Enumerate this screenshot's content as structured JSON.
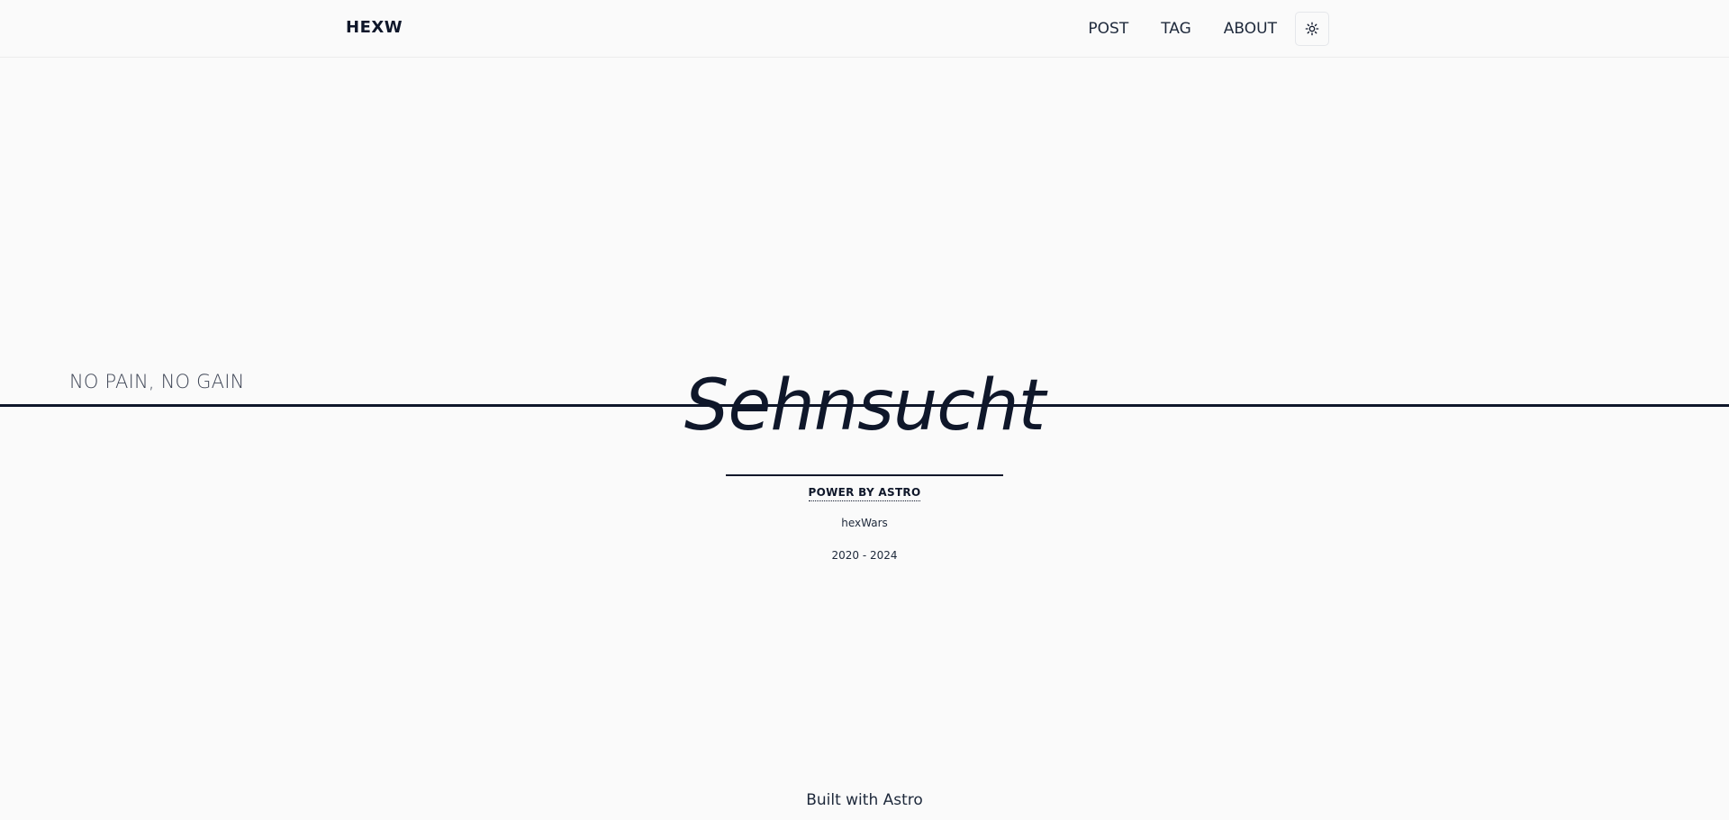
{
  "header": {
    "brand": "HEXW",
    "nav": [
      {
        "label": "POST"
      },
      {
        "label": "TAG"
      },
      {
        "label": "ABOUT"
      }
    ],
    "theme_toggle_icon": "sun-icon"
  },
  "hero": {
    "motto": "NO PAIN, NO GAIN",
    "title": "Sehnsucht",
    "power_label": "POWER BY ASTRO",
    "author": "hexWars",
    "years": "2020 - 2024"
  },
  "footer": {
    "built_with": "Built with Astro"
  },
  "colors": {
    "background": "#fafafa",
    "text": "#0f172a"
  }
}
